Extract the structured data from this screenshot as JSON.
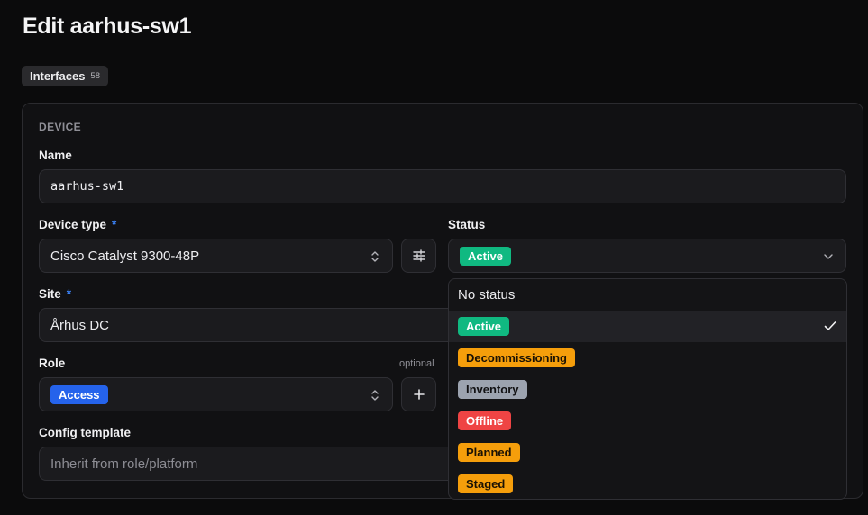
{
  "page": {
    "title": "Edit aarhus-sw1"
  },
  "tabs": [
    {
      "label": "Interfaces",
      "count": "58"
    }
  ],
  "section": {
    "label": "DEVICE"
  },
  "fields": {
    "name": {
      "label": "Name",
      "value": "aarhus-sw1"
    },
    "device_type": {
      "label": "Device type",
      "required_mark": "*",
      "value": "Cisco Catalyst 9300-48P"
    },
    "status": {
      "label": "Status",
      "value": "Active",
      "value_color": "#10b981"
    },
    "site": {
      "label": "Site",
      "required_mark": "*",
      "value": "Århus DC"
    },
    "role": {
      "label": "Role",
      "optional_label": "optional",
      "value": "Access",
      "value_color": "#2563eb"
    },
    "config_template": {
      "label": "Config template",
      "placeholder": "Inherit from role/platform"
    }
  },
  "status_dropdown": {
    "none_label": "No status",
    "options": [
      {
        "label": "Active",
        "color": "#10b981",
        "text_color": "#ffffff",
        "selected": true
      },
      {
        "label": "Decommissioning",
        "color": "#f59e0b",
        "text_color": "#1a1204",
        "selected": false
      },
      {
        "label": "Inventory",
        "color": "#9ca3af",
        "text_color": "#111113",
        "selected": false
      },
      {
        "label": "Offline",
        "color": "#ef4444",
        "text_color": "#ffffff",
        "selected": false
      },
      {
        "label": "Planned",
        "color": "#f59e0b",
        "text_color": "#1a1204",
        "selected": false
      },
      {
        "label": "Staged",
        "color": "#f59e0b",
        "text_color": "#1a1204",
        "selected": false
      }
    ]
  },
  "icons": {
    "device_type_action": "sliders-icon",
    "role_action": "plus-icon",
    "select_chevrons": "chevron-up-down-icon",
    "status_chevron": "chevron-down-icon",
    "selected_check": "check-icon"
  }
}
